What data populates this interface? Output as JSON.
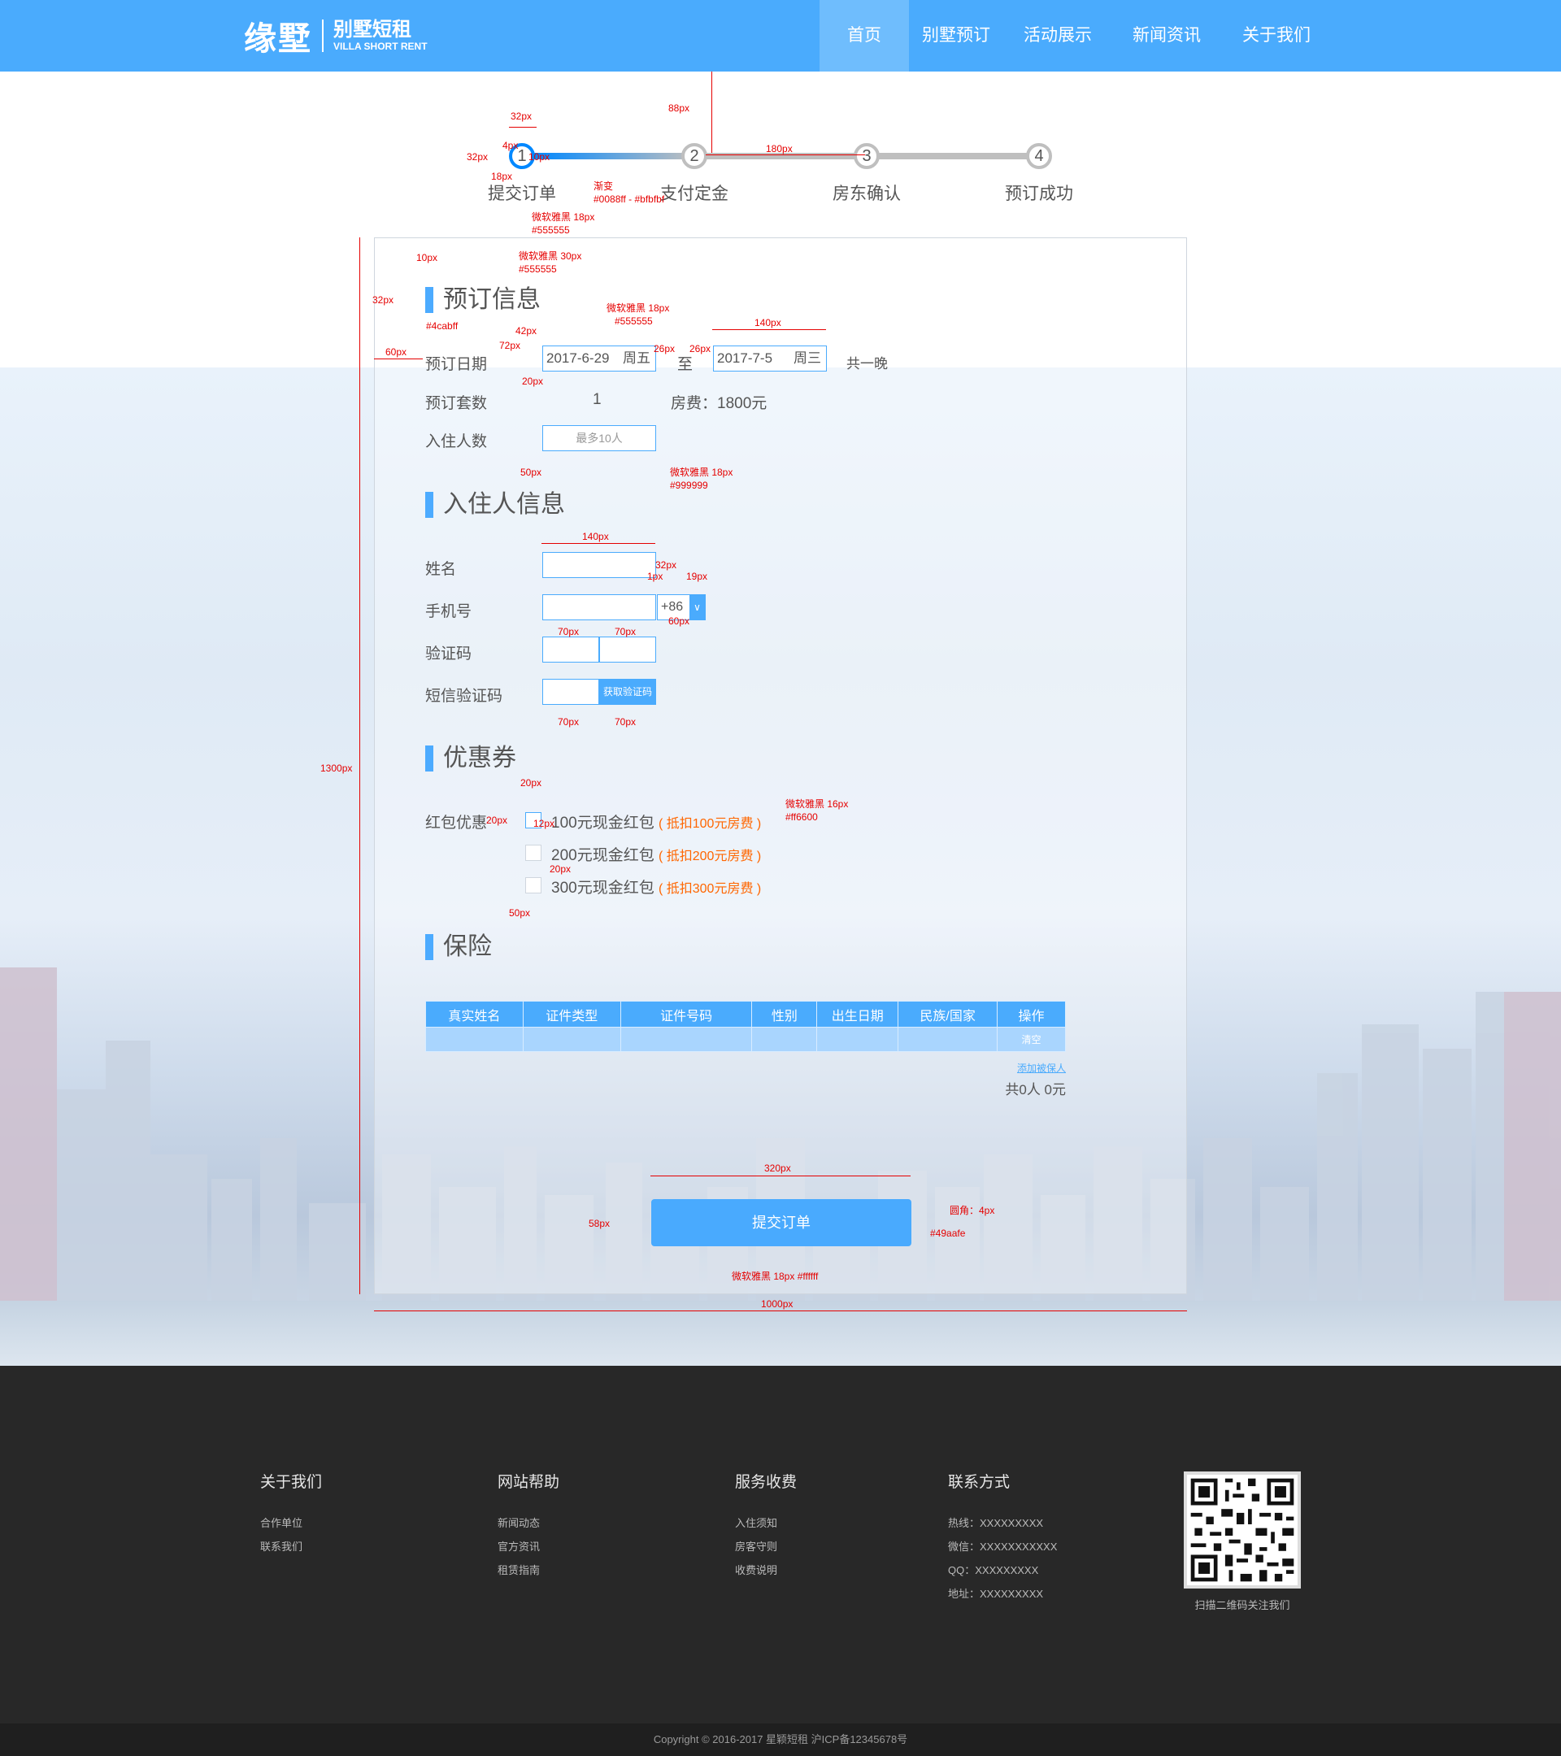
{
  "header": {
    "logo_cn": "缘墅",
    "logo_sub": "别墅短租",
    "logo_en": "VILLA SHORT RENT",
    "nav": [
      "首页",
      "别墅预订",
      "活动展示",
      "新闻资讯",
      "关于我们"
    ],
    "active_index": 0
  },
  "steps": {
    "items": [
      {
        "num": "1",
        "label": "提交订单"
      },
      {
        "num": "2",
        "label": "支付定金"
      },
      {
        "num": "3",
        "label": "房东确认"
      },
      {
        "num": "4",
        "label": "预订成功"
      }
    ],
    "current": 1
  },
  "booking": {
    "title": "预订信息",
    "date_label": "预订日期",
    "start_date": "2017-6-29",
    "start_dow": "周五",
    "to": "至",
    "end_date": "2017-7-5",
    "end_dow": "周三",
    "nights": "共一晚",
    "sets_label": "预订套数",
    "sets_value": "1",
    "fee": "房费：1800元",
    "guests_label": "入住人数",
    "guests_placeholder": "最多10人"
  },
  "guest": {
    "title": "入住人信息",
    "name_label": "姓名",
    "phone_label": "手机号",
    "country_code": "+86",
    "captcha_label": "验证码",
    "sms_label": "短信验证码",
    "sms_button": "获取验证码"
  },
  "coupon": {
    "title": "优惠券",
    "label": "红包优惠",
    "items": [
      {
        "text": "100元现金红包",
        "note": "( 抵扣100元房费 )"
      },
      {
        "text": "200元现金红包",
        "note": "( 抵扣200元房费 )"
      },
      {
        "text": "300元现金红包",
        "note": "( 抵扣300元房费 )"
      }
    ]
  },
  "insurance": {
    "title": "保险",
    "columns": [
      "真实姓名",
      "证件类型",
      "证件号码",
      "性别",
      "出生日期",
      "民族/国家",
      "操作"
    ],
    "row_action": "清空",
    "add_link": "添加被保人",
    "total": "共0人  0元"
  },
  "submit_label": "提交订单",
  "annotations": {
    "a32px": "32px",
    "a4px": "4px",
    "a10px": "10px",
    "a18px": "18px",
    "a88px": "88px",
    "a180px": "180px",
    "gradient_label": "渐变",
    "gradient_value": "#0088ff - #bfbfbf",
    "font18_555": "微软雅黑  18px",
    "c555": "#555555",
    "a10px_b": "10px",
    "font30": "微软雅黑  30px",
    "c555_b": "#555555",
    "a32px_b": "32px",
    "c4cabff": "#4cabff",
    "font18_b": "微软雅黑  18px",
    "c555_c": "#555555",
    "a42px": "42px",
    "a72px": "72px",
    "a60px": "60px",
    "a26px": "26px",
    "a26px_b": "26px",
    "a140px": "140px",
    "a32px_c": "32px",
    "a20px": "20px",
    "a50px": "50px",
    "font18_999": "微软雅黑  18px",
    "c999": "#999999",
    "a140px_b": "140px",
    "a32px_d": "32px",
    "a1px": "1px",
    "a19px": "19px",
    "a60px_b": "60px",
    "a70px_1": "70px",
    "a70px_2": "70px",
    "a70px_3": "70px",
    "a70px_4": "70px",
    "a1300px": "1300px",
    "a20px_b": "20px",
    "a20px_c": "20px",
    "a12px": "12px",
    "font16": "微软雅黑  16px",
    "cff6600": "#ff6600",
    "a20px_d": "20px",
    "a50px_b": "50px",
    "a320px": "320px",
    "a58px": "58px",
    "radius": "圆角：4px",
    "c49aafe": "#49aafe",
    "font18_fff": "微软雅黑  18px #ffffff",
    "a1000px": "1000px"
  },
  "footer": {
    "columns": [
      {
        "title": "关于我们",
        "items": [
          "合作单位",
          "联系我们"
        ]
      },
      {
        "title": "网站帮助",
        "items": [
          "新闻动态",
          "官方资讯",
          "租赁指南"
        ]
      },
      {
        "title": "服务收费",
        "items": [
          "入住须知",
          "房客守则",
          "收费说明"
        ]
      },
      {
        "title": "联系方式",
        "items": [
          "热线：XXXXXXXXX",
          "微信：XXXXXXXXXXX",
          "QQ：XXXXXXXXX",
          "地址：XXXXXXXXX"
        ]
      }
    ],
    "qr_caption": "扫描二维码关注我们",
    "copyright": "Copyright © 2016-2017 星颖短租 沪ICP备12345678号"
  },
  "colors": {
    "primary": "#4aabfd",
    "accent": "#ff6600",
    "text": "#555555",
    "footer_bg": "#282828",
    "step_active": "#0088ff",
    "step_inactive": "#bfbfbf"
  }
}
